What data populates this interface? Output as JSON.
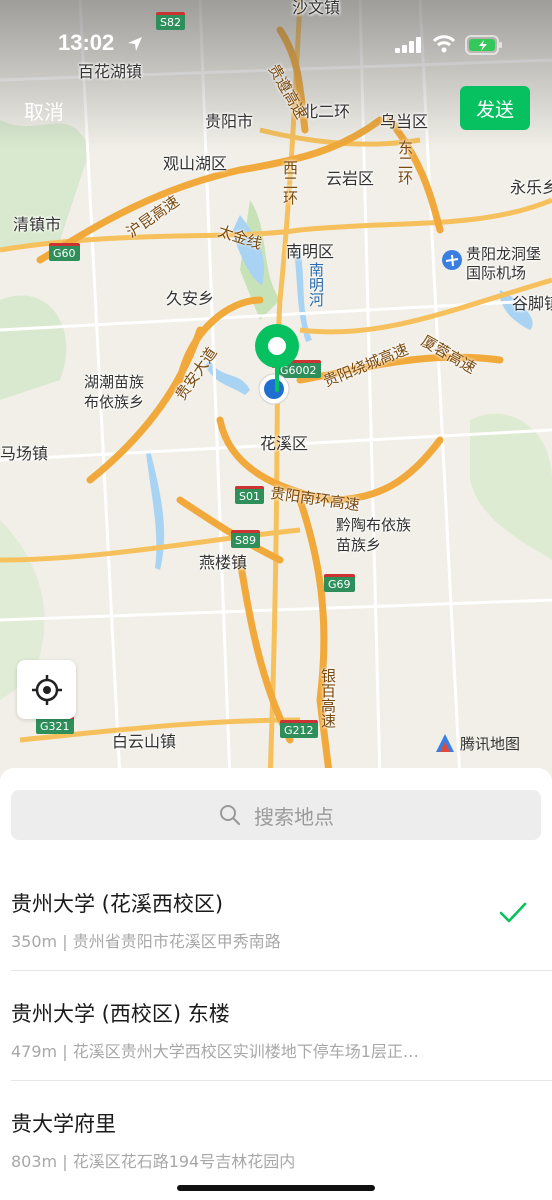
{
  "status_bar": {
    "time": "13:02"
  },
  "header": {
    "cancel_label": "取消",
    "send_label": "发送"
  },
  "map": {
    "places": [
      {
        "name": "place-baihuahu",
        "text": "百花湖镇"
      },
      {
        "name": "place-guiyang",
        "text": "贵阳市"
      },
      {
        "name": "place-beierhuan",
        "text": "北二环"
      },
      {
        "name": "place-wudang",
        "text": "乌当区"
      },
      {
        "name": "place-guanshanhu",
        "text": "观山湖区"
      },
      {
        "name": "place-yunyan",
        "text": "云岩区"
      },
      {
        "name": "place-yongle",
        "text": "永乐乡"
      },
      {
        "name": "place-qingzhen",
        "text": "清镇市"
      },
      {
        "name": "place-nanming",
        "text": "南明区"
      },
      {
        "name": "place-airport",
        "text": "贵阳龙洞堡\n国际机场"
      },
      {
        "name": "place-jiuan",
        "text": "久安乡"
      },
      {
        "name": "place-gujiao",
        "text": "谷脚镇"
      },
      {
        "name": "place-huchao",
        "text": "湖潮苗族\n布依族乡"
      },
      {
        "name": "place-machang",
        "text": "马场镇"
      },
      {
        "name": "place-huaxi",
        "text": "花溪区"
      },
      {
        "name": "place-qiantao",
        "text": "黔陶布依族\n苗族乡"
      },
      {
        "name": "place-yanlou",
        "text": "燕楼镇"
      },
      {
        "name": "place-baiyunshan",
        "text": "白云山镇"
      },
      {
        "name": "place-shawen",
        "text": "沙文镇"
      }
    ],
    "roads": [
      {
        "name": "road-gucheng",
        "text": "贵遵高速"
      },
      {
        "name": "road-xierhuan",
        "text": "西二环"
      },
      {
        "name": "road-dongerhuan",
        "text": "东二环"
      },
      {
        "name": "road-hukun",
        "text": "沪昆高速"
      },
      {
        "name": "road-taijin",
        "text": "太金线"
      },
      {
        "name": "road-guian",
        "text": "贵安大道"
      },
      {
        "name": "road-raocheng",
        "text": "贵阳绕城高速"
      },
      {
        "name": "road-xiarong",
        "text": "厦蓉高速"
      },
      {
        "name": "road-nanhuan",
        "text": "贵阳南环高速"
      },
      {
        "name": "road-yinbai",
        "text": "银百高速"
      }
    ],
    "river": "南明河",
    "shields": [
      {
        "name": "shield-s82",
        "text": "S82"
      },
      {
        "name": "shield-g60",
        "text": "G60"
      },
      {
        "name": "shield-g6002",
        "text": "G6002"
      },
      {
        "name": "shield-s01",
        "text": "S01"
      },
      {
        "name": "shield-s89",
        "text": "S89"
      },
      {
        "name": "shield-g69",
        "text": "G69"
      },
      {
        "name": "shield-g321",
        "text": "G321"
      },
      {
        "name": "shield-g212",
        "text": "G212"
      }
    ],
    "brand": "腾讯地图"
  },
  "search": {
    "placeholder": "搜索地点"
  },
  "results": [
    {
      "name": "贵州大学 (花溪西校区)",
      "address": "350m | 贵州省贵阳市花溪区甲秀南路",
      "selected": true
    },
    {
      "name": "贵州大学 (西校区) 东楼",
      "address": "479m | 花溪区贵州大学西校区实训楼地下停车场1层正…",
      "selected": false
    },
    {
      "name": "贵大学府里",
      "address": "803m | 花溪区花石路194号吉林花园内",
      "selected": false
    }
  ],
  "colors": {
    "accent": "#07c160",
    "road": "#f6c15c",
    "highway": "#f0a93a",
    "water": "#a9d3f2",
    "park": "#cfe6c6"
  }
}
